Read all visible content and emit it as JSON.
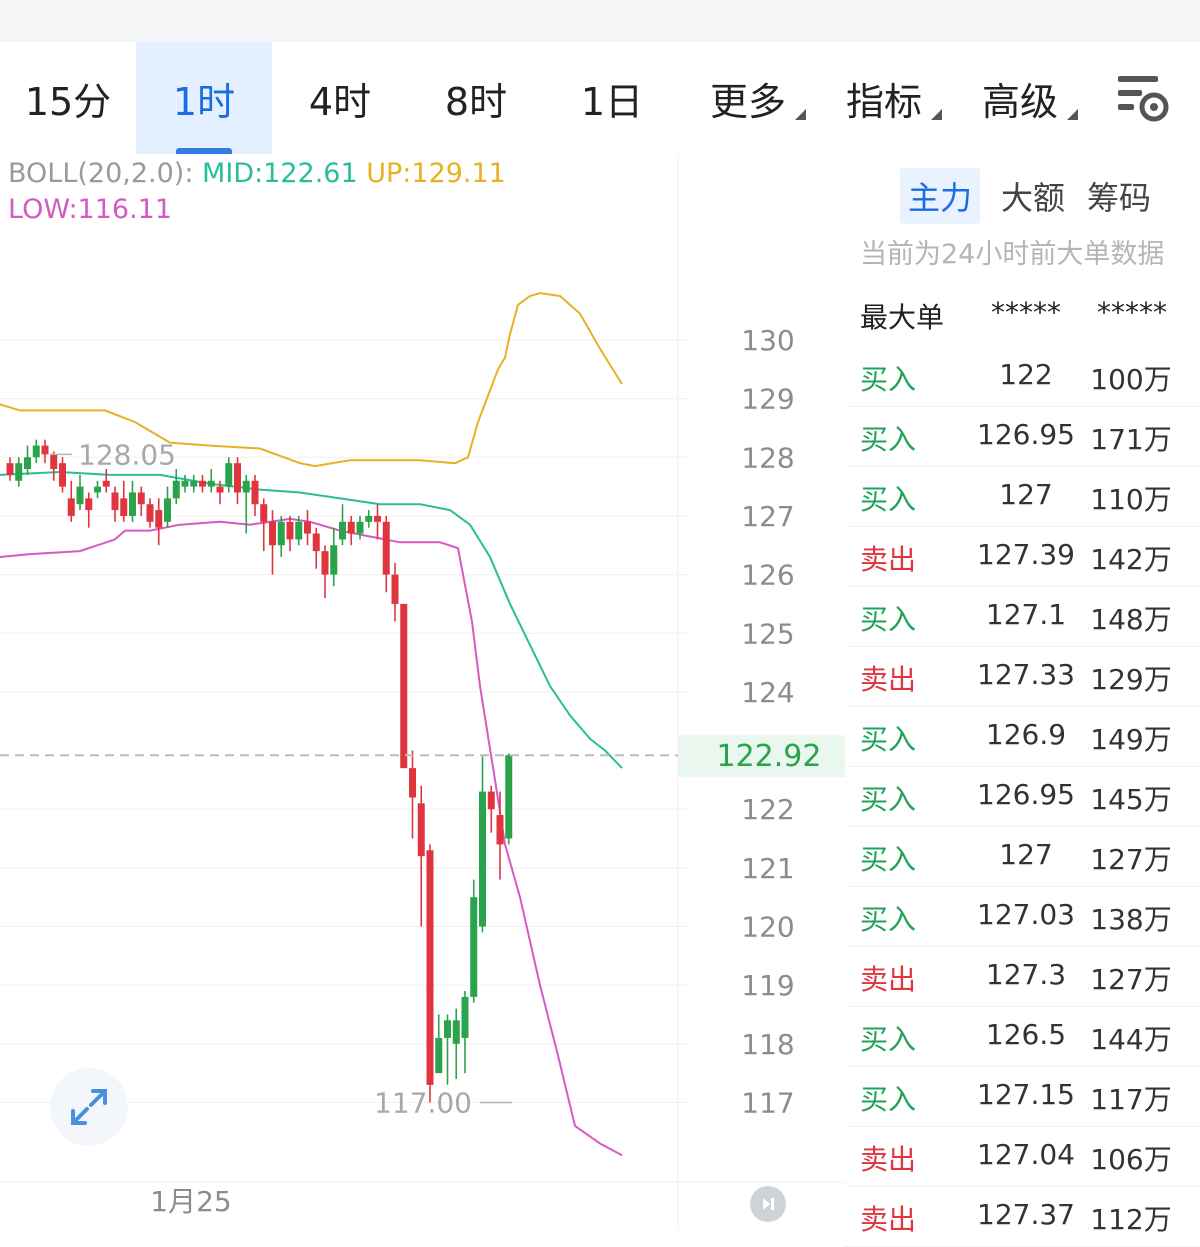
{
  "tabs": [
    {
      "label": "15分",
      "active": false,
      "dropdown": false
    },
    {
      "label": "1时",
      "active": true,
      "dropdown": false
    },
    {
      "label": "4时",
      "active": false,
      "dropdown": false
    },
    {
      "label": "8时",
      "active": false,
      "dropdown": false
    },
    {
      "label": "1日",
      "active": false,
      "dropdown": false
    },
    {
      "label": "更多",
      "active": false,
      "dropdown": true
    },
    {
      "label": "指标",
      "active": false,
      "dropdown": true
    },
    {
      "label": "高级",
      "active": false,
      "dropdown": true
    }
  ],
  "settings_icon": "chart-settings-icon",
  "indicator": {
    "label": "BOLL(20,2.0):",
    "mid": "MID:122.61",
    "up": "UP:129.11",
    "low": "LOW:116.11"
  },
  "colors": {
    "up_candle": "#2ba24c",
    "down_candle": "#e0353f",
    "mid_line": "#2bbc9b",
    "up_line": "#e8b023",
    "low_line": "#d55ac2",
    "accent": "#1a6de0"
  },
  "chart_data": {
    "type": "candlestick",
    "y_ticks": [
      "130",
      "129",
      "128",
      "127",
      "126",
      "125",
      "124",
      "122",
      "121",
      "120",
      "119",
      "118",
      "117"
    ],
    "ylim": [
      116,
      130.6
    ],
    "current_price": "122.92",
    "high_marker": "128.05",
    "low_marker": "117.00",
    "x_label": "1月25",
    "candles": [
      [
        127.9,
        127.7,
        128.0,
        127.6
      ],
      [
        127.6,
        127.9,
        128.0,
        127.5
      ],
      [
        127.8,
        128.0,
        128.2,
        127.7
      ],
      [
        128.0,
        128.2,
        128.3,
        127.9
      ],
      [
        128.2,
        128.05,
        128.3,
        127.9
      ],
      [
        128.05,
        127.8,
        128.1,
        127.6
      ],
      [
        127.9,
        127.5,
        128.0,
        127.4
      ],
      [
        127.3,
        127.0,
        127.6,
        126.9
      ],
      [
        127.2,
        127.5,
        127.7,
        127.1
      ],
      [
        127.3,
        127.1,
        127.4,
        126.8
      ],
      [
        127.4,
        127.5,
        127.6,
        127.3
      ],
      [
        127.6,
        127.5,
        127.8,
        127.4
      ],
      [
        127.4,
        127.1,
        127.5,
        126.9
      ],
      [
        127.3,
        127.0,
        127.6,
        126.9
      ],
      [
        127.0,
        127.4,
        127.6,
        126.9
      ],
      [
        127.4,
        127.2,
        127.5,
        127.0
      ],
      [
        127.2,
        126.9,
        127.3,
        126.8
      ],
      [
        127.1,
        126.8,
        127.3,
        126.5
      ],
      [
        126.9,
        127.3,
        127.5,
        126.8
      ],
      [
        127.3,
        127.6,
        127.8,
        127.2
      ],
      [
        127.5,
        127.6,
        127.7,
        127.4
      ],
      [
        127.5,
        127.6,
        127.7,
        127.4
      ],
      [
        127.6,
        127.5,
        127.7,
        127.4
      ],
      [
        127.5,
        127.6,
        127.8,
        127.4
      ],
      [
        127.5,
        127.4,
        127.6,
        127.2
      ],
      [
        127.5,
        127.9,
        128.0,
        127.4
      ],
      [
        127.9,
        127.4,
        128.0,
        127.2
      ],
      [
        127.4,
        127.6,
        127.7,
        126.7
      ],
      [
        127.6,
        127.2,
        127.7,
        127.0
      ],
      [
        127.2,
        126.9,
        127.3,
        126.4
      ],
      [
        126.9,
        126.5,
        127.1,
        126.0
      ],
      [
        126.5,
        126.9,
        127.0,
        126.3
      ],
      [
        126.9,
        126.6,
        127.0,
        126.4
      ],
      [
        126.6,
        126.9,
        127.0,
        126.5
      ],
      [
        126.9,
        126.7,
        127.1,
        126.5
      ],
      [
        126.7,
        126.4,
        126.8,
        126.1
      ],
      [
        126.4,
        126.0,
        126.5,
        125.6
      ],
      [
        126.0,
        126.5,
        126.8,
        125.8
      ],
      [
        126.6,
        126.9,
        127.2,
        126.5
      ],
      [
        126.9,
        126.7,
        127.0,
        126.5
      ],
      [
        126.7,
        126.9,
        127.0,
        126.6
      ],
      [
        126.9,
        127.0,
        127.1,
        126.8
      ],
      [
        127.0,
        126.9,
        127.2,
        126.6
      ],
      [
        126.9,
        126.0,
        127.0,
        125.7
      ],
      [
        126.0,
        125.5,
        126.2,
        125.2
      ],
      [
        125.5,
        122.7,
        125.5,
        122.7
      ],
      [
        122.7,
        122.2,
        123.0,
        121.5
      ],
      [
        122.1,
        121.2,
        122.4,
        120.0
      ],
      [
        121.3,
        117.3,
        121.4,
        117.0
      ],
      [
        117.5,
        118.1,
        118.5,
        117.5
      ],
      [
        118.1,
        118.4,
        118.5,
        117.3
      ],
      [
        118.0,
        118.4,
        118.6,
        117.4
      ],
      [
        118.1,
        118.8,
        118.9,
        117.5
      ],
      [
        118.8,
        120.5,
        120.8,
        118.7
      ],
      [
        120.0,
        122.3,
        122.9,
        119.9
      ],
      [
        122.3,
        122.0,
        122.4,
        121.6
      ],
      [
        121.9,
        121.4,
        122.3,
        120.8
      ],
      [
        121.5,
        122.92,
        122.95,
        121.4
      ]
    ],
    "mid": [
      [
        0,
        127.7
      ],
      [
        60,
        127.75
      ],
      [
        110,
        127.7
      ],
      [
        160,
        127.7
      ],
      [
        210,
        127.55
      ],
      [
        260,
        127.45
      ],
      [
        300,
        127.4
      ],
      [
        340,
        127.3
      ],
      [
        380,
        127.2
      ],
      [
        420,
        127.2
      ],
      [
        450,
        127.1
      ],
      [
        470,
        126.85
      ],
      [
        490,
        126.3
      ],
      [
        510,
        125.5
      ],
      [
        530,
        124.8
      ],
      [
        550,
        124.1
      ],
      [
        570,
        123.6
      ],
      [
        590,
        123.2
      ],
      [
        605,
        123.0
      ],
      [
        622,
        122.7
      ]
    ],
    "up": [
      [
        0,
        128.9
      ],
      [
        20,
        128.8
      ],
      [
        50,
        128.8
      ],
      [
        105,
        128.8
      ],
      [
        135,
        128.6
      ],
      [
        170,
        128.25
      ],
      [
        210,
        128.2
      ],
      [
        260,
        128.15
      ],
      [
        300,
        127.9
      ],
      [
        315,
        127.85
      ],
      [
        350,
        127.95
      ],
      [
        420,
        127.95
      ],
      [
        455,
        127.9
      ],
      [
        468,
        128.0
      ],
      [
        478,
        128.6
      ],
      [
        498,
        129.5
      ],
      [
        505,
        129.7
      ],
      [
        510,
        130.1
      ],
      [
        518,
        130.6
      ],
      [
        530,
        130.75
      ],
      [
        540,
        130.8
      ],
      [
        560,
        130.75
      ],
      [
        580,
        130.45
      ],
      [
        600,
        129.85
      ],
      [
        622,
        129.25
      ]
    ],
    "low": [
      [
        0,
        126.3
      ],
      [
        30,
        126.35
      ],
      [
        80,
        126.4
      ],
      [
        115,
        126.6
      ],
      [
        125,
        126.75
      ],
      [
        150,
        126.75
      ],
      [
        180,
        126.85
      ],
      [
        220,
        126.9
      ],
      [
        250,
        126.85
      ],
      [
        290,
        126.95
      ],
      [
        310,
        126.9
      ],
      [
        340,
        126.75
      ],
      [
        370,
        126.65
      ],
      [
        400,
        126.55
      ],
      [
        440,
        126.55
      ],
      [
        458,
        126.45
      ],
      [
        472,
        125.2
      ],
      [
        480,
        124.1
      ],
      [
        495,
        122.5
      ],
      [
        505,
        121.4
      ],
      [
        520,
        120.5
      ],
      [
        540,
        119.0
      ],
      [
        558,
        117.8
      ],
      [
        575,
        116.6
      ],
      [
        600,
        116.3
      ],
      [
        622,
        116.1
      ]
    ]
  },
  "expand_icon": "expand-arrows-icon",
  "skip_icon": "skip-to-latest-icon",
  "panel": {
    "tabs": [
      {
        "label": "主力",
        "active": true
      },
      {
        "label": "大额",
        "active": false
      },
      {
        "label": "筹码",
        "active": false
      }
    ],
    "note": "当前为24小时前大单数据",
    "header": {
      "col1": "最大单",
      "col2": "*****",
      "col3": "*****"
    },
    "rows": [
      {
        "side": "买入",
        "type": "buy",
        "price": "122",
        "amount": "100万"
      },
      {
        "side": "买入",
        "type": "buy",
        "price": "126.95",
        "amount": "171万"
      },
      {
        "side": "买入",
        "type": "buy",
        "price": "127",
        "amount": "110万"
      },
      {
        "side": "卖出",
        "type": "sell",
        "price": "127.39",
        "amount": "142万"
      },
      {
        "side": "买入",
        "type": "buy",
        "price": "127.1",
        "amount": "148万"
      },
      {
        "side": "卖出",
        "type": "sell",
        "price": "127.33",
        "amount": "129万"
      },
      {
        "side": "买入",
        "type": "buy",
        "price": "126.9",
        "amount": "149万"
      },
      {
        "side": "买入",
        "type": "buy",
        "price": "126.95",
        "amount": "145万"
      },
      {
        "side": "买入",
        "type": "buy",
        "price": "127",
        "amount": "127万"
      },
      {
        "side": "买入",
        "type": "buy",
        "price": "127.03",
        "amount": "138万"
      },
      {
        "side": "卖出",
        "type": "sell",
        "price": "127.3",
        "amount": "127万"
      },
      {
        "side": "买入",
        "type": "buy",
        "price": "126.5",
        "amount": "144万"
      },
      {
        "side": "买入",
        "type": "buy",
        "price": "127.15",
        "amount": "117万"
      },
      {
        "side": "卖出",
        "type": "sell",
        "price": "127.04",
        "amount": "106万"
      },
      {
        "side": "卖出",
        "type": "sell",
        "price": "127.37",
        "amount": "112万"
      }
    ]
  }
}
